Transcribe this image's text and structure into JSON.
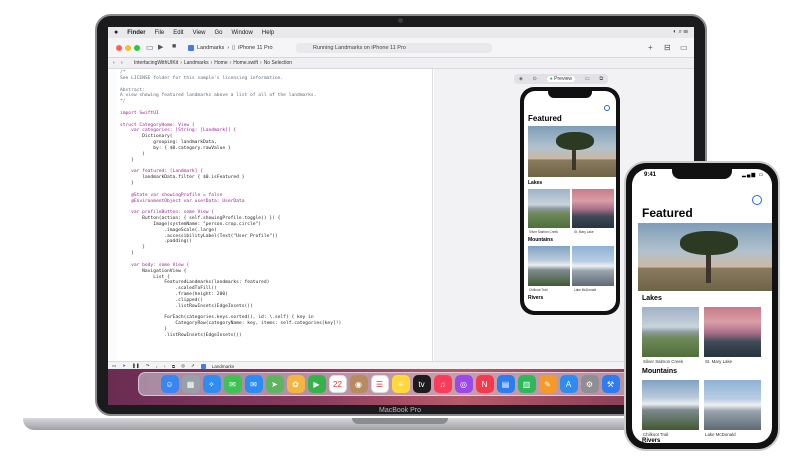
{
  "macbook": {
    "brand_label": "MacBook Pro"
  },
  "menubar": {
    "apple": "",
    "items": [
      "Finder",
      "File",
      "Edit",
      "View",
      "Go",
      "Window",
      "Help"
    ]
  },
  "toolbar": {
    "scheme_target": "Landmarks",
    "scheme_device": "iPhone 11 Pro",
    "status": "Running Landmarks on iPhone 11 Pro",
    "add_icon": "+",
    "split_icon": "⊟"
  },
  "jumpbar": {
    "crumbs": [
      "InterfacingWithUIKit",
      "Landmarks",
      "Home",
      "Home.swift",
      "No Selection"
    ]
  },
  "editor": {
    "code_lines": [
      "/*",
      "See LICENSE folder for this sample's licensing information.",
      "",
      "Abstract:",
      "A view showing featured landmarks above a list of all of the landmarks.",
      "*/",
      "",
      "import SwiftUI",
      "",
      "struct CategoryHome: View {",
      "    var categories: [String: [Landmark]] {",
      "        Dictionary(",
      "            grouping: landmarkData,",
      "            by: { $0.category.rawValue }",
      "        )",
      "    }",
      "",
      "    var featured: [Landmark] {",
      "        landmarkData.filter { $0.isFeatured }",
      "    }",
      "",
      "    @State var showingProfile = false",
      "    @EnvironmentObject var userData: UserData",
      "",
      "    var profileButton: some View {",
      "        Button(action: { self.showingProfile.toggle() }) {",
      "            Image(systemName: \"person.crop.circle\")",
      "                .imageScale(.large)",
      "                .accessibilityLabel(Text(\"User Profile\"))",
      "                .padding()",
      "        }",
      "    }",
      "",
      "    var body: some View {",
      "        NavigationView {",
      "            List {",
      "                FeaturedLandmarks(landmarks: featured)",
      "                    .scaledToFill()",
      "                    .frame(height: 200)",
      "                    .clipped()",
      "                    .listRowInsets(EdgeInsets())",
      "",
      "                ForEach(categories.keys.sorted(), id: \\.self) { key in",
      "                    CategoryRow(categoryName: key, items: self.categories[key]!)",
      "                }",
      "                .listRowInsets(EdgeInsets())"
    ],
    "bottom_tab": "Landmarks"
  },
  "preview": {
    "label": "Preview"
  },
  "app": {
    "title": "Featured",
    "sections": [
      {
        "name": "Lakes",
        "items": [
          "Silver Salmon Creek",
          "St. Mary Lake"
        ]
      },
      {
        "name": "Mountains",
        "items": [
          "Chilkoot Trail",
          "Lake McDonald"
        ]
      },
      {
        "name": "Rivers",
        "items": []
      }
    ]
  },
  "iphone": {
    "time": "9:41"
  },
  "dock": {
    "apps": [
      {
        "name": "finder",
        "color": "#3a86f0",
        "glyph": "☺"
      },
      {
        "name": "launchpad",
        "color": "#9aa0a8",
        "glyph": "▦"
      },
      {
        "name": "safari",
        "color": "#2f8df2",
        "glyph": "✧"
      },
      {
        "name": "messages",
        "color": "#3dc253",
        "glyph": "✉"
      },
      {
        "name": "mail",
        "color": "#2c8cf4",
        "glyph": "✉"
      },
      {
        "name": "maps",
        "color": "#5fb461",
        "glyph": "➤"
      },
      {
        "name": "photos",
        "color": "#f4b640",
        "glyph": "✿"
      },
      {
        "name": "facetime",
        "color": "#36b24a",
        "glyph": "▶"
      },
      {
        "name": "calendar",
        "color": "#ffffff",
        "glyph": "22"
      },
      {
        "name": "contacts",
        "color": "#b88b5e",
        "glyph": "◉"
      },
      {
        "name": "reminders",
        "color": "#ffffff",
        "glyph": "☰"
      },
      {
        "name": "notes",
        "color": "#ffd93b",
        "glyph": "≡"
      },
      {
        "name": "tv",
        "color": "#1c1c1e",
        "glyph": "tv"
      },
      {
        "name": "music",
        "color": "#fb3c58",
        "glyph": "♫"
      },
      {
        "name": "podcasts",
        "color": "#9b4ae6",
        "glyph": "◎"
      },
      {
        "name": "news",
        "color": "#f53a4d",
        "glyph": "N"
      },
      {
        "name": "keynote",
        "color": "#2c7df0",
        "glyph": "▤"
      },
      {
        "name": "numbers",
        "color": "#2fb85a",
        "glyph": "▥"
      },
      {
        "name": "pages",
        "color": "#f59b2e",
        "glyph": "✎"
      },
      {
        "name": "app-store",
        "color": "#2e8cf0",
        "glyph": "A"
      },
      {
        "name": "system-preferences",
        "color": "#8e8e93",
        "glyph": "⚙"
      },
      {
        "name": "xcode",
        "color": "#2f7bf0",
        "glyph": "⚒"
      }
    ]
  }
}
